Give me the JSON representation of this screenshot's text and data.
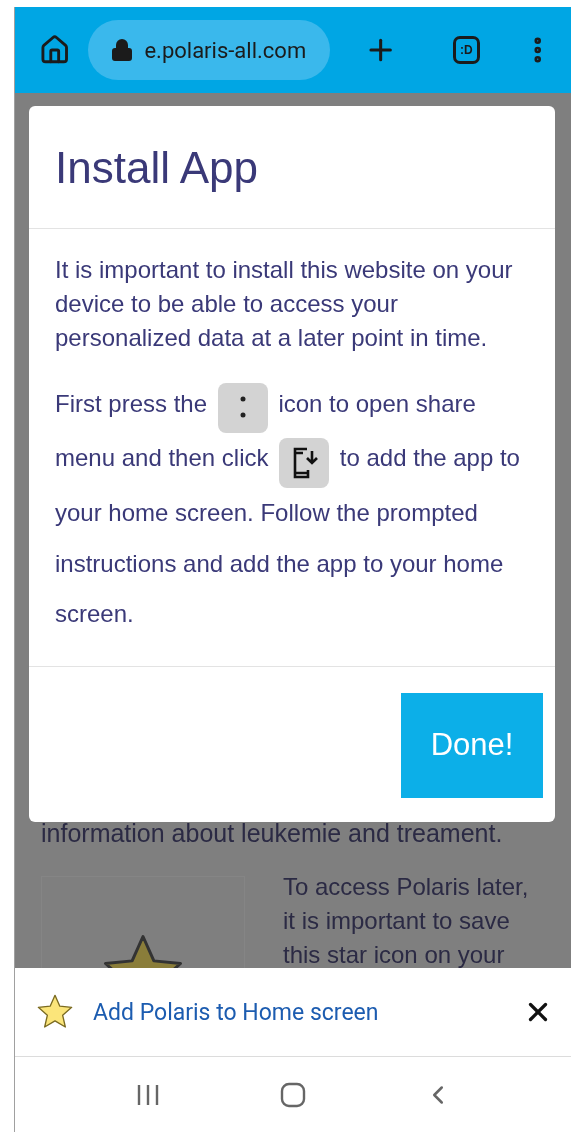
{
  "browser_bar": {
    "url": "e.polaris-all.com",
    "tab_switcher": ":D"
  },
  "background_page": {
    "partial_line": "information about leukemie and treament.",
    "card_text": "To access Polaris later, it is important to save this star icon on your"
  },
  "dialog": {
    "title": "Install App",
    "intro": "It is important to install this website on your device to be able to access your personalized data at a later point in time.",
    "steps": [
      {
        "kind": "text",
        "text": "First press the"
      },
      {
        "kind": "dots"
      },
      {
        "kind": "text",
        "text": "icon to open share menu and then click"
      },
      {
        "kind": "install"
      },
      {
        "kind": "text",
        "text": "to add the app to your home screen. Follow the prompted instructions and add the app to your home screen."
      }
    ],
    "button": "Done!"
  },
  "install_banner": {
    "label": "Add Polaris to Home screen"
  }
}
